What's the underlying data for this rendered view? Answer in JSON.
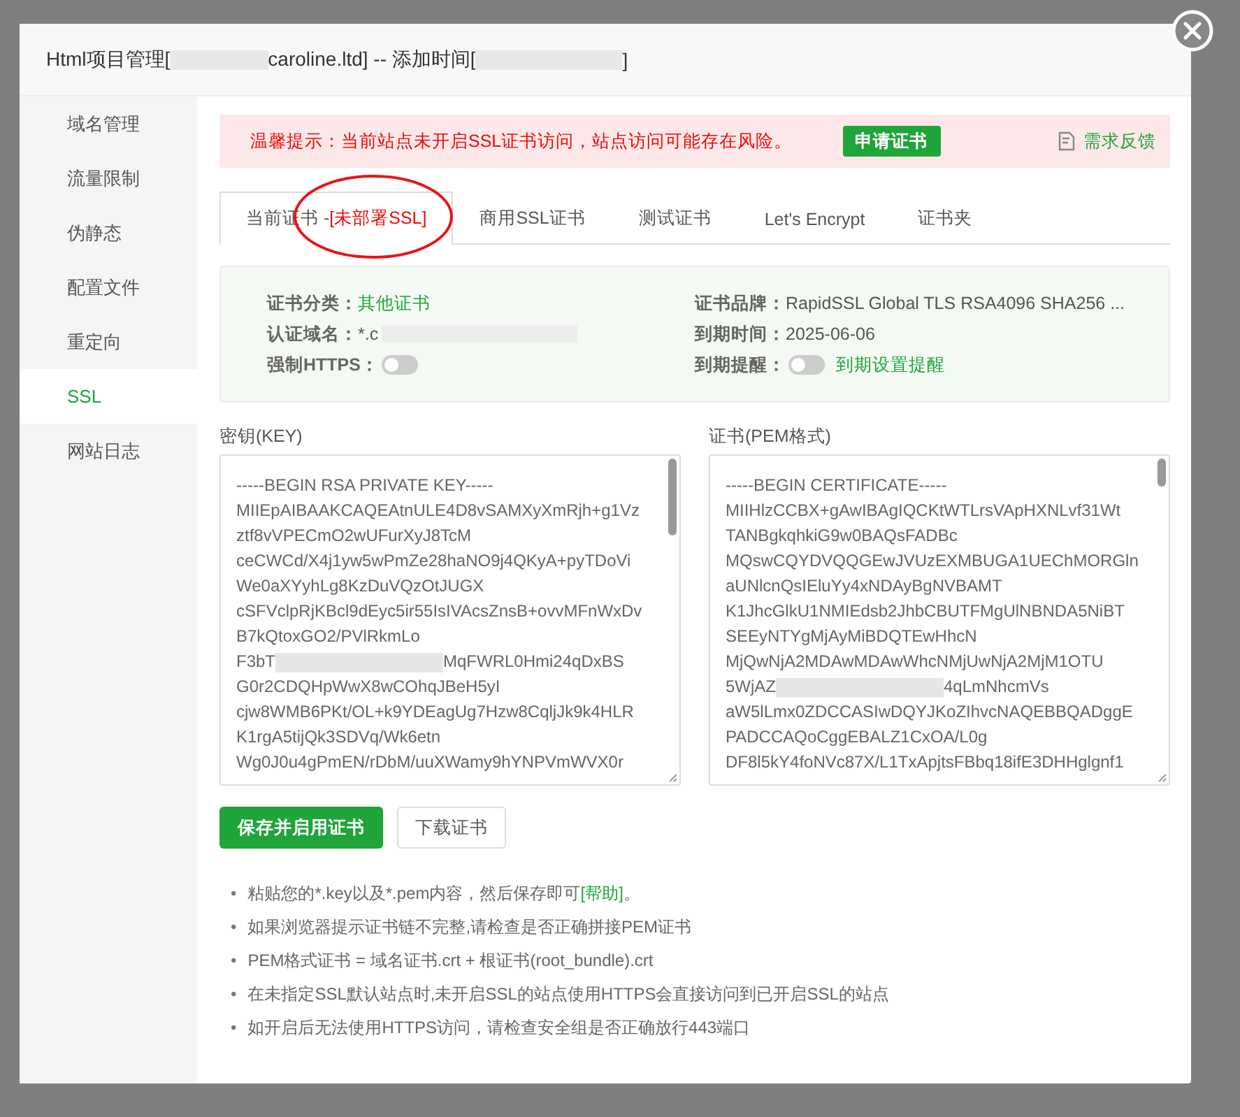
{
  "window": {
    "title_parts": [
      "Html项目管理[",
      "caroline.ltd] -- 添加时间[",
      "]"
    ]
  },
  "sidebar": {
    "items": [
      {
        "label": "域名管理",
        "selected": false
      },
      {
        "label": "流量限制",
        "selected": false
      },
      {
        "label": "伪静态",
        "selected": false
      },
      {
        "label": "配置文件",
        "selected": false
      },
      {
        "label": "重定向",
        "selected": false
      },
      {
        "label": "SSL",
        "selected": true
      },
      {
        "label": "网站日志",
        "selected": false
      }
    ]
  },
  "alert": {
    "text": "温馨提示：当前站点未开启SSL证书访问，站点访问可能存在风险。",
    "button": "申请证书",
    "feedback": "需求反馈"
  },
  "tabs": [
    {
      "label": "当前证书 -",
      "status": "[未部署SSL]",
      "selected": true
    },
    {
      "label": "商用SSL证书",
      "selected": false
    },
    {
      "label": "测试证书",
      "selected": false
    },
    {
      "label": "Let's Encrypt",
      "selected": false
    },
    {
      "label": "证书夹",
      "selected": false
    }
  ],
  "cert_info": [
    {
      "label": "证书分类：",
      "kind": "text",
      "value": "其他证书",
      "accent": true
    },
    {
      "label": "证书品牌：",
      "kind": "text",
      "value": "RapidSSL Global TLS RSA4096 SHA256 ...",
      "accent": false
    },
    {
      "label": "认证域名：",
      "kind": "redacted",
      "value": "*.c"
    },
    {
      "label": "到期时间：",
      "kind": "text",
      "value": "2025-06-06",
      "accent": false
    },
    {
      "label": "强制HTTPS：",
      "kind": "toggle",
      "on": false
    },
    {
      "label": "到期提醒：",
      "kind": "toggle",
      "on": false,
      "link": "到期设置提醒"
    }
  ],
  "key": {
    "label": "密钥(KEY)",
    "lines": [
      {
        "kind": "text",
        "text": "-----BEGIN RSA PRIVATE KEY-----"
      },
      {
        "kind": "text",
        "text": "MIIEpAIBAAKCAQEAtnULE4D8vSAMXyXmRjh+g1Vz"
      },
      {
        "kind": "text",
        "text": "ztf8vVPECmO2wUFurXyJ8TcM"
      },
      {
        "kind": "text",
        "text": "ceCWCd/X4j1yw5wPmZe28haNO9j4QKyA+pyTDoVi"
      },
      {
        "kind": "text",
        "text": "We0aXYyhLg8KzDuVQzOtJUGX"
      },
      {
        "kind": "text",
        "text": "cSFVclpRjKBcl9dEyc5ir55IsIVAcsZnsB+ovvMFnWxDv"
      },
      {
        "kind": "text",
        "text": "B7kQtoxGO2/PVlRkmLo"
      },
      {
        "kind": "redacted",
        "start": "F3bT",
        "end": "MqFWRL0Hmi24qDxBS"
      },
      {
        "kind": "text",
        "text": "G0r2CDQHpWwX8wCOhqJBeH5yI"
      },
      {
        "kind": "text",
        "text": "cjw8WMB6PKt/OL+k9YDEagUg7Hzw8CqljJk9k4HLR"
      },
      {
        "kind": "text",
        "text": "K1rgA5tijQk3SDVq/Wk6etn"
      },
      {
        "kind": "text",
        "text": "Wg0J0u4gPmEN/rDbM/uuXWamy9hYNPVmWVX0r"
      }
    ]
  },
  "certificate": {
    "label": "证书(PEM格式)",
    "lines": [
      {
        "kind": "text",
        "text": "-----BEGIN CERTIFICATE-----"
      },
      {
        "kind": "text",
        "text": "MIIHlzCCBX+gAwIBAgIQCKtWTLrsVApHXNLvf31Wt"
      },
      {
        "kind": "text",
        "text": "TANBgkqhkiG9w0BAQsFADBc"
      },
      {
        "kind": "text",
        "text": "MQswCQYDVQQGEwJVUzEXMBUGA1UEChMORGln"
      },
      {
        "kind": "text",
        "text": "aUNlcnQsIEluYy4xNDAyBgNVBAMT"
      },
      {
        "kind": "text",
        "text": "K1JhcGlkU1NMIEdsb2JhbCBUTFMgUlNBNDA5NiBT"
      },
      {
        "kind": "text",
        "text": "SEEyNTYgMjAyMiBDQTEwHhcN"
      },
      {
        "kind": "text",
        "text": "MjQwNjA2MDAwMDAwWhcNMjUwNjA2MjM1OTU"
      },
      {
        "kind": "redacted",
        "start": "5WjAZ",
        "end": "4qLmNhcmVs"
      },
      {
        "kind": "text",
        "text": "aW5lLmx0ZDCCASIwDQYJKoZIhvcNAQEBBQADggE"
      },
      {
        "kind": "text",
        "text": "PADCCAQoCggEBALZ1CxOA/L0g"
      },
      {
        "kind": "text",
        "text": "DF8l5kY4foNVc87X/L1TxApjtsFBbq18ifE3DHHglgnf1"
      }
    ]
  },
  "buttons": {
    "save": "保存并启用证书",
    "download": "下载证书"
  },
  "notes": [
    {
      "marker": "•",
      "text": "粘贴您的*.key以及*.pem内容，然后保存即可",
      "link": "[帮助]",
      "after": "。"
    },
    {
      "marker": "•",
      "text": "如果浏览器提示证书链不完整,请检查是否正确拼接PEM证书"
    },
    {
      "marker": "•",
      "text": "PEM格式证书 = 域名证书.crt + 根证书(root_bundle).crt"
    },
    {
      "marker": "•",
      "text": "在未指定SSL默认站点时,未开启SSL的站点使用HTTPS会直接访问到已开启SSL的站点"
    },
    {
      "marker": "•",
      "text": "如开启后无法使用HTTPS访问，请检查安全组是否正确放行443端口"
    }
  ]
}
